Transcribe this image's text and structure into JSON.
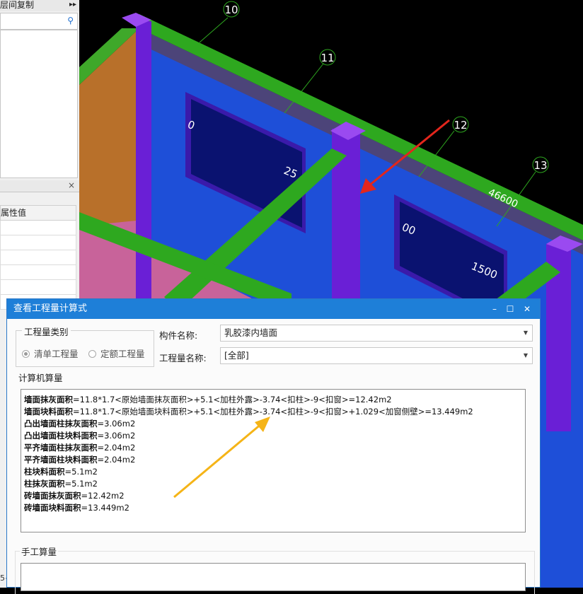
{
  "left_panel": {
    "title": "层间复制",
    "title_arrows": "▸▸",
    "search_icon": "search-icon",
    "close_label": "×",
    "grid_header": "属性值",
    "bottom_text": "5~"
  },
  "viewport": {
    "axis_labels": [
      "10",
      "11",
      "12",
      "13"
    ],
    "dimensions": [
      "0",
      "25",
      "46600",
      "00",
      "1500"
    ]
  },
  "dialog": {
    "title": "查看工程量计算式",
    "controls": {
      "minimize": "–",
      "maximize": "☐",
      "close": "✕"
    },
    "category_group": {
      "legend": "工程量类别",
      "options": [
        {
          "label": "清单工程量",
          "checked": true
        },
        {
          "label": "定额工程量",
          "checked": false
        }
      ]
    },
    "component_name": {
      "label": "构件名称:",
      "value": "乳胶漆内墙面"
    },
    "quantity_name": {
      "label": "工程量名称:",
      "value": "[全部]"
    },
    "computer_calc_label": "计算机算量",
    "calc_lines": [
      {
        "name": "墙面抹灰面积",
        "expr": "=11.8*1.7<原始墙面抹灰面积>+5.1<加柱外露>-3.74<扣柱>-9<扣窗>=12.42m2"
      },
      {
        "name": "墙面块料面积",
        "expr": "=11.8*1.7<原始墙面块料面积>+5.1<加柱外露>-3.74<扣柱>-9<扣窗>+1.029<加窗侧壁>=13.449m2"
      },
      {
        "name": "凸出墙面柱抹灰面积",
        "expr": "=3.06m2"
      },
      {
        "name": "凸出墙面柱块料面积",
        "expr": "=3.06m2"
      },
      {
        "name": "平齐墙面柱抹灰面积",
        "expr": "=2.04m2"
      },
      {
        "name": "平齐墙面柱块料面积",
        "expr": "=2.04m2"
      },
      {
        "name": "柱块料面积",
        "expr": "=5.1m2"
      },
      {
        "name": "柱抹灰面积",
        "expr": "=5.1m2"
      },
      {
        "name": "砖墙面抹灰面积",
        "expr": "=12.42m2"
      },
      {
        "name": "砖墙面块料面积",
        "expr": "=13.449m2"
      }
    ],
    "manual_calc_label": "手工算量"
  },
  "colors": {
    "wall_blue": "#1e4fd8",
    "column_purple": "#6a1fd6",
    "beam_green": "#2ea81f",
    "floor_pink": "#c8639a",
    "side_brown": "#b8702a",
    "window_navy": "#0a1270",
    "title_blue": "#1e7fd8",
    "red_arrow": "#e3261c",
    "yellow_arrow": "#f5b417"
  }
}
